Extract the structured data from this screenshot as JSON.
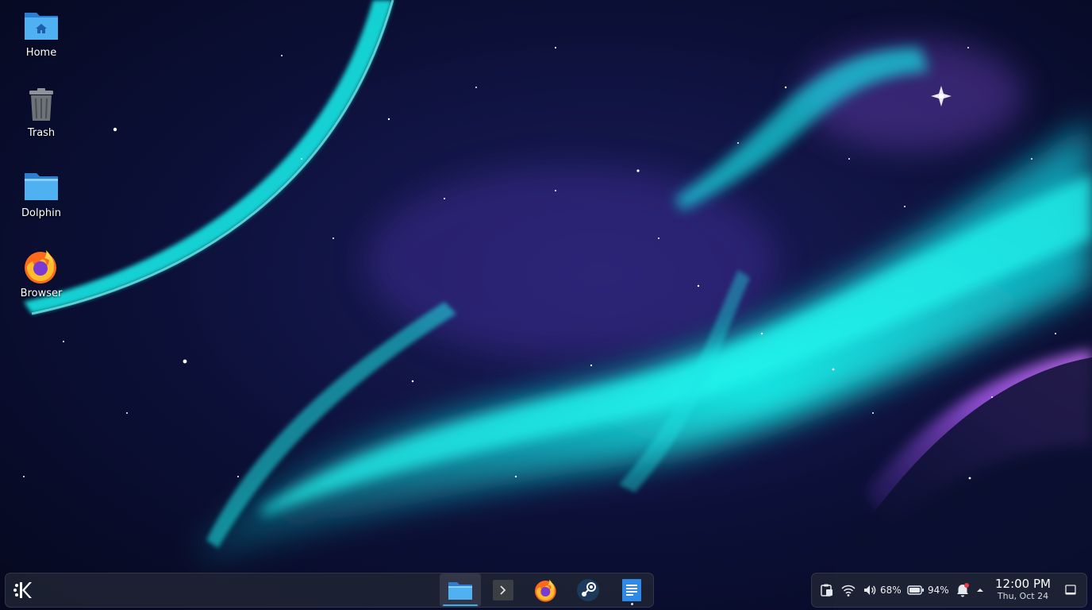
{
  "desktop": {
    "icons": [
      {
        "label": "Home"
      },
      {
        "label": "Trash"
      },
      {
        "label": "Dolphin"
      },
      {
        "label": "Browser"
      }
    ]
  },
  "taskbar": {
    "launcher_icon": "kde-logo-icon",
    "tasks": [
      {
        "icon": "folder-icon",
        "state": "active"
      },
      {
        "icon": "terminal-icon",
        "state": "idle"
      },
      {
        "icon": "firefox-icon",
        "state": "idle"
      },
      {
        "icon": "steam-icon",
        "state": "idle"
      },
      {
        "icon": "text-editor-icon",
        "state": "running"
      }
    ]
  },
  "tray": {
    "volume_percent": "68%",
    "battery_percent": "94%",
    "time": "12:00 PM",
    "date": "Thu, Oct 24"
  },
  "colors": {
    "accent": "#3daee9",
    "aurora_cyan": "#19e8e6",
    "aurora_violet": "#8a4fd8",
    "notification_badge": "#e93c4a"
  }
}
